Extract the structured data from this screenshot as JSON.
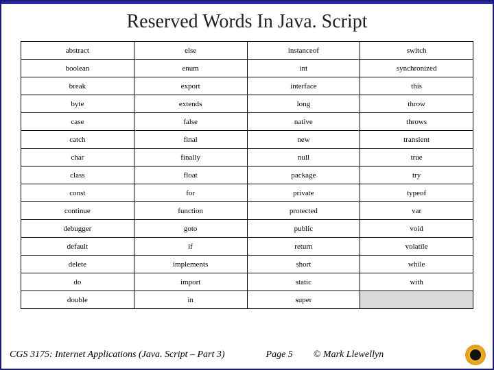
{
  "title": "Reserved Words In Java. Script",
  "table": {
    "rows": [
      [
        "abstract",
        "else",
        "instanceof",
        "switch"
      ],
      [
        "boolean",
        "enum",
        "int",
        "synchronized"
      ],
      [
        "break",
        "export",
        "interface",
        "this"
      ],
      [
        "byte",
        "extends",
        "long",
        "throw"
      ],
      [
        "case",
        "false",
        "native",
        "throws"
      ],
      [
        "catch",
        "final",
        "new",
        "transient"
      ],
      [
        "char",
        "finally",
        "null",
        "true"
      ],
      [
        "class",
        "float",
        "package",
        "try"
      ],
      [
        "const",
        "for",
        "private",
        "typeof"
      ],
      [
        "continue",
        "function",
        "protected",
        "var"
      ],
      [
        "debugger",
        "goto",
        "public",
        "void"
      ],
      [
        "default",
        "if",
        "return",
        "volatile"
      ],
      [
        "delete",
        "implements",
        "short",
        "while"
      ],
      [
        "do",
        "import",
        "static",
        "with"
      ],
      [
        "double",
        "in",
        "super",
        ""
      ]
    ]
  },
  "footer": {
    "course": "CGS 3175: Internet Applications (Java. Script – Part 3)",
    "page": "Page 5",
    "author": "© Mark Llewellyn"
  }
}
